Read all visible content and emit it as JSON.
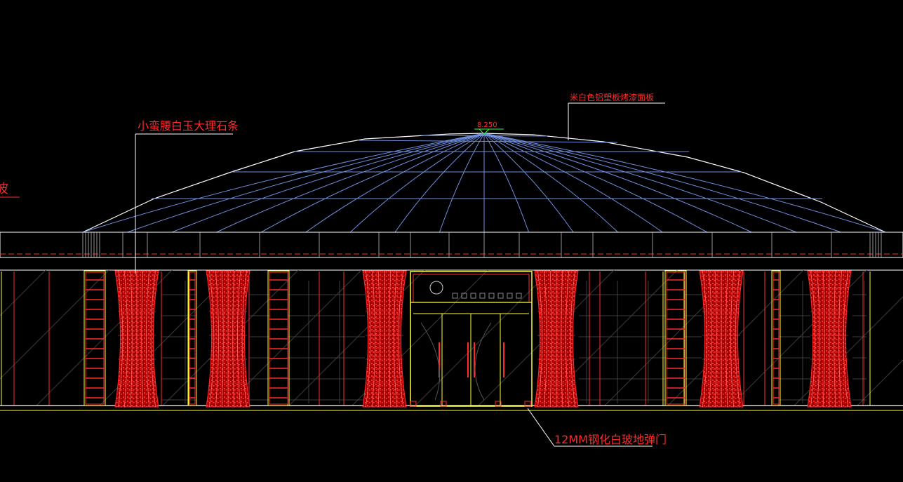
{
  "drawing": {
    "level_mark": "8.250",
    "annotations": {
      "marble_strip": "小蛮腰白玉大理石条",
      "top_right_note": "米白色铝塑板烤漆面板",
      "door_note": "12MM钢化白玻地弹门",
      "left_cut_note": "波"
    }
  },
  "colors": {
    "background": "#000000",
    "outline": "#ffffff",
    "dome_grid": "#6f8fe0",
    "annotation": "#ff2a2a",
    "frame": "#ffff33",
    "accent_green": "#33ff33"
  }
}
